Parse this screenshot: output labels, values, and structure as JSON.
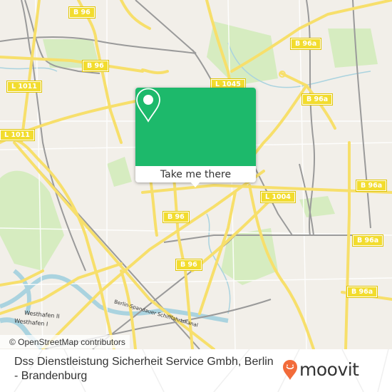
{
  "map": {
    "provider": "OpenStreetMap",
    "attribution": "© OpenStreetMap contributors",
    "colors": {
      "land": "#f2efe9",
      "park": "#cdebb0",
      "water": "#aad3df",
      "road": "#f7df6b",
      "rail": "#999999"
    },
    "road_labels": [
      {
        "id": "b96-top",
        "text": "B 96"
      },
      {
        "id": "b96-mid",
        "text": "B 96"
      },
      {
        "id": "l1011-a",
        "text": "L 1011"
      },
      {
        "id": "l1011-b",
        "text": "L 1011"
      },
      {
        "id": "b96a-top",
        "text": "B 96a"
      },
      {
        "id": "l1045",
        "text": "L 1045"
      },
      {
        "id": "b96a-b",
        "text": "B 96a"
      },
      {
        "id": "b96a-c",
        "text": "B 96a"
      },
      {
        "id": "l1004",
        "text": "L 1004"
      },
      {
        "id": "b96a-d",
        "text": "B 96a"
      },
      {
        "id": "b96a-e",
        "text": "B 96a"
      },
      {
        "id": "b96-c",
        "text": "B 96"
      },
      {
        "id": "b96-d",
        "text": "B 96"
      }
    ],
    "water_labels": [
      {
        "id": "westhafen-2",
        "text": "Westhafen II"
      },
      {
        "id": "westhafen-1",
        "text": "Westhafen I"
      },
      {
        "id": "canal",
        "text": "Berlin-Spandauer Schifffahrtskanal"
      }
    ]
  },
  "popup": {
    "icon": "map-pin-icon",
    "button_label": "Take me there",
    "accent": "#1db96b"
  },
  "footer": {
    "place_name": "Dss Dienstleistung Sicherheit Service Gmbh, Berlin - Brandenburg",
    "logo_text": "moovit",
    "logo_color": "#f26b3a"
  }
}
